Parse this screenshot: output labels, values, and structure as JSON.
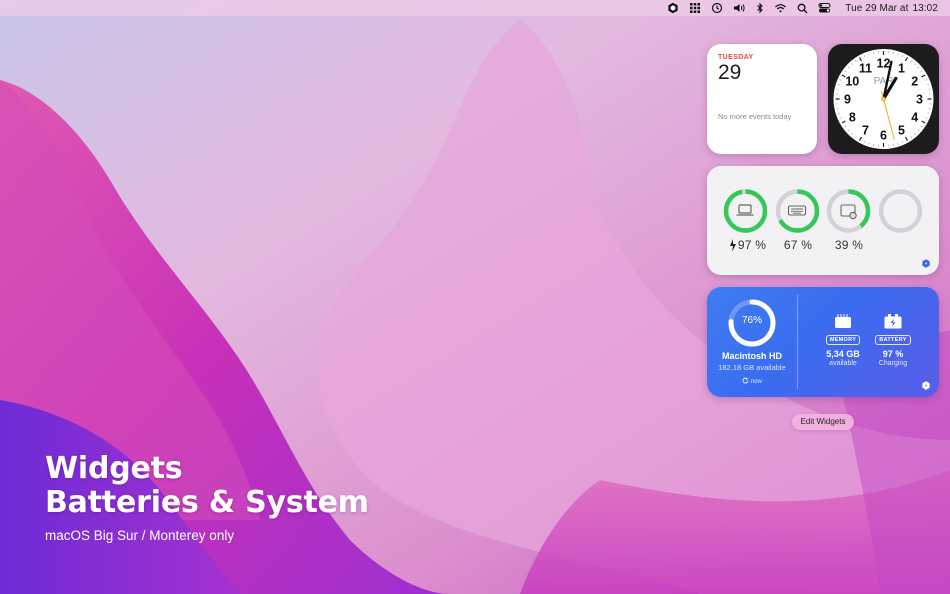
{
  "menubar": {
    "icons": [
      "hexagon-app-icon",
      "grid-icon",
      "time-machine-icon",
      "volume-icon",
      "bluetooth-icon",
      "wifi-icon",
      "search-icon",
      "control-center-icon"
    ],
    "date": "Tue 29 Mar at",
    "time": "13:02"
  },
  "calendar_widget": {
    "weekday": "TUESDAY",
    "day": "29",
    "note": "No more events today",
    "accent": "#e5483e"
  },
  "clock_widget": {
    "city": "PAR",
    "numbers": [
      "12",
      "1",
      "2",
      "3",
      "4",
      "5",
      "6",
      "7",
      "8",
      "9",
      "10",
      "11"
    ],
    "time": "13:02"
  },
  "batteries_widget": {
    "devices": [
      {
        "icon": "laptop-icon",
        "percent_text": "97 %",
        "level": 0.97,
        "charging": true
      },
      {
        "icon": "keyboard-icon",
        "percent_text": "67 %",
        "level": 0.67,
        "charging": false
      },
      {
        "icon": "trackpad-icon",
        "percent_text": "39 %",
        "level": 0.39,
        "charging": false
      },
      {
        "icon": "empty-slot",
        "percent_text": "",
        "level": 0,
        "charging": false
      }
    ],
    "ring_color": "#34c759"
  },
  "system_widget": {
    "disk_percent_text": "76%",
    "disk_level": 0.76,
    "disk_name": "Macintosh HD",
    "disk_free": "182,18 GB available",
    "updated": "now",
    "memory_label": "MEMORY",
    "memory_value": "5,34 GB",
    "memory_sub": "available",
    "battery_label": "BATTERY",
    "battery_value": "97 %",
    "battery_sub": "Charging"
  },
  "edit_button": "Edit Widgets",
  "promo": {
    "line1": "Widgets",
    "line2": "Batteries & System",
    "subtitle": "macOS Big Sur / Monterey only"
  }
}
